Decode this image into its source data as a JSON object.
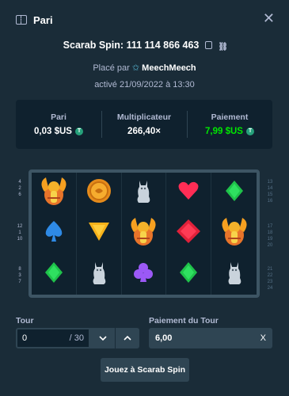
{
  "header": {
    "title": "Pari",
    "close_icon": "close-icon"
  },
  "game": {
    "label": "Scarab Spin:",
    "bet_id": "111 114 866 463",
    "copy_icon": "copy-icon",
    "link_icon": "link-icon"
  },
  "placed": {
    "prefix": "Placé par",
    "user": "MeechMeech",
    "user_icon": "star-icon"
  },
  "activated": "activé 21/09/2022 à 13:30",
  "stats": [
    {
      "label": "Pari",
      "value": "0,03 $US",
      "coin": "T",
      "color": "#ffffff"
    },
    {
      "label": "Multiplicateur",
      "value": "266,40×",
      "coin": "",
      "color": "#ffffff"
    },
    {
      "label": "Paiement",
      "value": "7,99 $US",
      "coin": "T",
      "color": "#00e701"
    }
  ],
  "reels": [
    [
      "scarab",
      "coin",
      "cat-statue",
      "heart",
      "green-diamond"
    ],
    [
      "spade",
      "yellow-triangle",
      "scarab",
      "red-diamond",
      "scarab"
    ],
    [
      "green-diamond",
      "cat-statue",
      "club",
      "green-diamond",
      "cat-statue"
    ]
  ],
  "paylines_left": [
    [
      "4",
      "2",
      "6"
    ],
    [
      "12",
      "1",
      "10"
    ],
    [
      "8",
      "3",
      "7"
    ]
  ],
  "paylines_right": [
    [
      "13",
      "14",
      "15",
      "16"
    ],
    [
      "17",
      "18",
      "19",
      "20"
    ],
    [
      "21",
      "22",
      "23",
      "24"
    ]
  ],
  "tour": {
    "label": "Tour",
    "value": "0",
    "total": "/ 30"
  },
  "tour_payout": {
    "label": "Paiement du Tour",
    "value": "6,00",
    "clear": "X"
  },
  "play_button": "Jouez à Scarab Spin"
}
